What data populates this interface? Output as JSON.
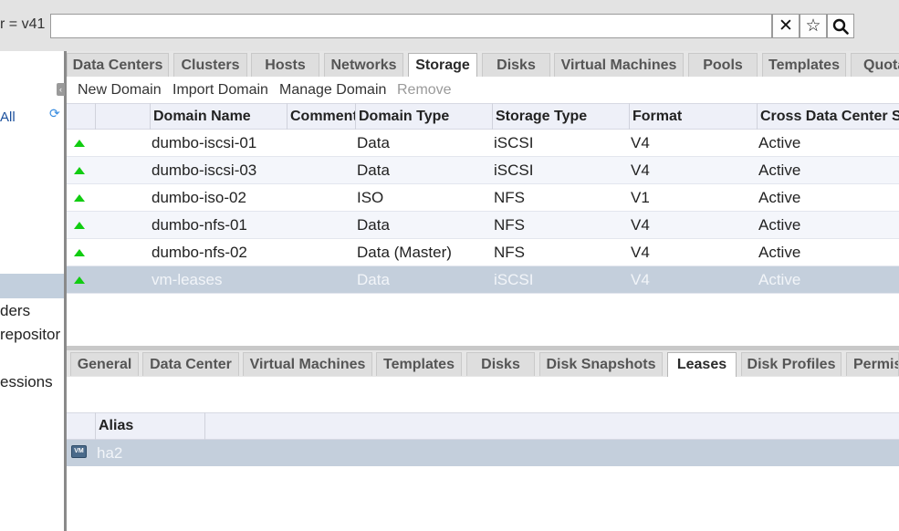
{
  "search": {
    "prefix": "r = v41",
    "value": "",
    "clear_icon": "close-icon",
    "bookmark_icon": "star-icon",
    "search_icon": "search-icon"
  },
  "left_panel": {
    "all_label": "All",
    "items": [
      "ders",
      "repositor",
      "essions"
    ]
  },
  "main_tabs": [
    {
      "label": "Data Centers",
      "active": false
    },
    {
      "label": "Clusters",
      "active": false
    },
    {
      "label": "Hosts",
      "active": false
    },
    {
      "label": "Networks",
      "active": false
    },
    {
      "label": "Storage",
      "active": true
    },
    {
      "label": "Disks",
      "active": false
    },
    {
      "label": "Virtual Machines",
      "active": false
    },
    {
      "label": "Pools",
      "active": false
    },
    {
      "label": "Templates",
      "active": false
    },
    {
      "label": "Quota",
      "active": false
    }
  ],
  "actions": [
    {
      "label": "New Domain",
      "enabled": true
    },
    {
      "label": "Import Domain",
      "enabled": true
    },
    {
      "label": "Manage Domain",
      "enabled": true
    },
    {
      "label": "Remove",
      "enabled": false
    }
  ],
  "storage_table": {
    "columns": [
      "Domain Name",
      "Comment",
      "Domain Type",
      "Storage Type",
      "Format",
      "Cross Data Center Status"
    ],
    "rows": [
      {
        "status": "up",
        "name": "dumbo-iscsi-01",
        "comment": "",
        "domain_type": "Data",
        "storage_type": "iSCSI",
        "format": "V4",
        "cross_dc": "Active",
        "selected": false
      },
      {
        "status": "up",
        "name": "dumbo-iscsi-03",
        "comment": "",
        "domain_type": "Data",
        "storage_type": "iSCSI",
        "format": "V4",
        "cross_dc": "Active",
        "selected": false
      },
      {
        "status": "up",
        "name": "dumbo-iso-02",
        "comment": "",
        "domain_type": "ISO",
        "storage_type": "NFS",
        "format": "V1",
        "cross_dc": "Active",
        "selected": false
      },
      {
        "status": "up",
        "name": "dumbo-nfs-01",
        "comment": "",
        "domain_type": "Data",
        "storage_type": "NFS",
        "format": "V4",
        "cross_dc": "Active",
        "selected": false
      },
      {
        "status": "up",
        "name": "dumbo-nfs-02",
        "comment": "",
        "domain_type": "Data (Master)",
        "storage_type": "NFS",
        "format": "V4",
        "cross_dc": "Active",
        "selected": false
      },
      {
        "status": "up",
        "name": "vm-leases",
        "comment": "",
        "domain_type": "Data",
        "storage_type": "iSCSI",
        "format": "V4",
        "cross_dc": "Active",
        "selected": true
      }
    ]
  },
  "sub_tabs": [
    {
      "label": "General",
      "active": false
    },
    {
      "label": "Data Center",
      "active": false
    },
    {
      "label": "Virtual Machines",
      "active": false
    },
    {
      "label": "Templates",
      "active": false
    },
    {
      "label": "Disks",
      "active": false
    },
    {
      "label": "Disk Snapshots",
      "active": false
    },
    {
      "label": "Leases",
      "active": true
    },
    {
      "label": "Disk Profiles",
      "active": false
    },
    {
      "label": "Permissions",
      "active": false
    }
  ],
  "leases_table": {
    "columns": [
      "Alias"
    ],
    "rows": [
      {
        "icon": "vm-icon",
        "alias": "ha2",
        "selected": true
      }
    ]
  },
  "colors": {
    "status_up": "#11cc11",
    "selected_row": "#c4cfdc",
    "header_bg": "#eef0f8",
    "link": "#1a4f9c"
  }
}
